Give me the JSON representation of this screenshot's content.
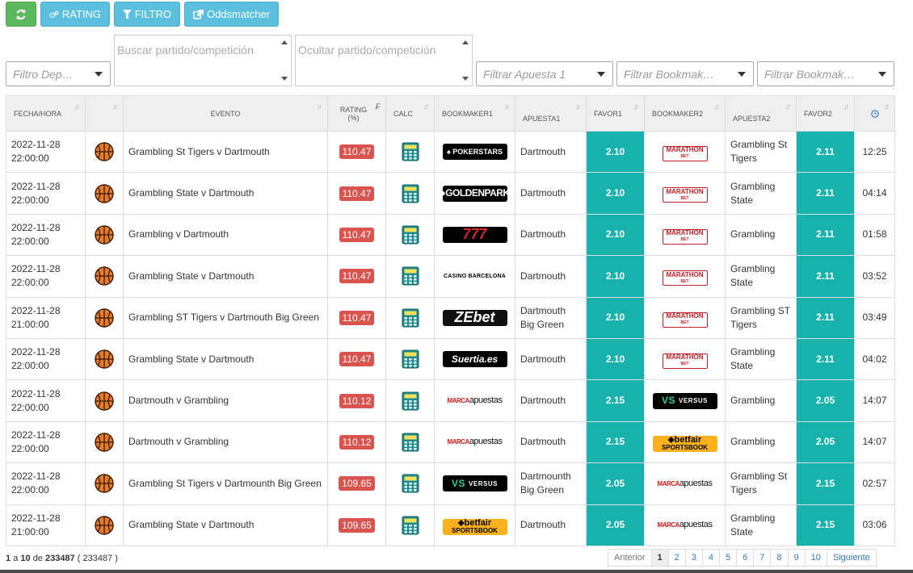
{
  "toolbar": {
    "refresh_icon": "refresh-icon",
    "rating_label": "RATING",
    "filtro_label": "FILTRO",
    "oddsmatcher_label": "Oddsmatcher"
  },
  "filters": {
    "deporte_placeholder": "Filtro Dep…",
    "buscar_placeholder": "Buscar partido/competición",
    "ocultar_placeholder": "Ocultar partido/competición",
    "apuesta1_placeholder": "Filtrar Apuesta 1",
    "bookmaker1_placeholder": "Filtrar Bookmak…",
    "bookmaker2_placeholder": "Filtrar Bookmak…"
  },
  "table": {
    "headers": {
      "fecha": "FECHA/HORA",
      "evento": "EVENTO",
      "rating": "RATING\n(%)",
      "calc": "CALC",
      "bookmaker1": "BOOKMAKER1",
      "apuesta1": "APUESTA1",
      "favor1": "FAVOR1",
      "bookmaker2": "BOOKMAKER2",
      "apuesta2": "APUESTA2",
      "favor2": "FAVOR2"
    },
    "rows": [
      {
        "date": "2022-11-28",
        "time": "22:00:00",
        "event": "Grambling St Tigers v Dartmouth",
        "rating": "110.47",
        "bookmaker1": "pokerstars",
        "apuesta1": "Dartmouth",
        "favor1": "2.10",
        "bookmaker2": "marathon",
        "apuesta2": "Grambling St Tigers",
        "favor2": "2.11",
        "age": "12:25"
      },
      {
        "date": "2022-11-28",
        "time": "22:00:00",
        "event": "Grambling State v Dartmouth",
        "rating": "110.47",
        "bookmaker1": "goldenpark",
        "apuesta1": "Dartmouth",
        "favor1": "2.10",
        "bookmaker2": "marathon",
        "apuesta2": "Grambling State",
        "favor2": "2.11",
        "age": "04:14"
      },
      {
        "date": "2022-11-28",
        "time": "22:00:00",
        "event": "Grambling v Dartmouth",
        "rating": "110.47",
        "bookmaker1": "777",
        "apuesta1": "Dartmouth",
        "favor1": "2.10",
        "bookmaker2": "marathon",
        "apuesta2": "Grambling",
        "favor2": "2.11",
        "age": "01:58"
      },
      {
        "date": "2022-11-28",
        "time": "22:00:00",
        "event": "Grambling State v Dartmouth",
        "rating": "110.47",
        "bookmaker1": "casino",
        "apuesta1": "Dartmouth",
        "favor1": "2.10",
        "bookmaker2": "marathon",
        "apuesta2": "Grambling State",
        "favor2": "2.11",
        "age": "03:52"
      },
      {
        "date": "2022-11-28",
        "time": "21:00:00",
        "event": "Grambling ST Tigers v Dartmouth Big Green",
        "rating": "110.47",
        "bookmaker1": "zebet",
        "apuesta1": "Dartmouth Big Green",
        "favor1": "2.10",
        "bookmaker2": "marathon",
        "apuesta2": "Grambling ST Tigers",
        "favor2": "2.11",
        "age": "03:49"
      },
      {
        "date": "2022-11-28",
        "time": "22:00:00",
        "event": "Grambling State v Dartmouth",
        "rating": "110.47",
        "bookmaker1": "suertia",
        "apuesta1": "Dartmouth",
        "favor1": "2.10",
        "bookmaker2": "marathon",
        "apuesta2": "Grambling State",
        "favor2": "2.11",
        "age": "04:02"
      },
      {
        "date": "2022-11-28",
        "time": "22:00:00",
        "event": "Dartmouth v Grambling",
        "rating": "110.12",
        "bookmaker1": "marca",
        "apuesta1": "Dartmouth",
        "favor1": "2.15",
        "bookmaker2": "versus",
        "apuesta2": "Grambling",
        "favor2": "2.05",
        "age": "14:07"
      },
      {
        "date": "2022-11-28",
        "time": "22:00:00",
        "event": "Dartmouth v Grambling",
        "rating": "110.12",
        "bookmaker1": "marca",
        "apuesta1": "Dartmouth",
        "favor1": "2.15",
        "bookmaker2": "betfair",
        "apuesta2": "Grambling",
        "favor2": "2.05",
        "age": "14:07"
      },
      {
        "date": "2022-11-28",
        "time": "22:00:00",
        "event": "Grambling St Tigers v Dartmounth Big Green",
        "rating": "109.65",
        "bookmaker1": "versus",
        "apuesta1": "Dartmounth Big Green",
        "favor1": "2.05",
        "bookmaker2": "marca",
        "apuesta2": "Grambling St Tigers",
        "favor2": "2.15",
        "age": "02:57"
      },
      {
        "date": "2022-11-28",
        "time": "21:00:00",
        "event": "Grambling State v Dartmouth",
        "rating": "109.65",
        "bookmaker1": "betfair",
        "apuesta1": "Dartmouth",
        "favor1": "2.05",
        "bookmaker2": "marca",
        "apuesta2": "Grambling State",
        "favor2": "2.15",
        "age": "03:06"
      }
    ]
  },
  "logos": {
    "pokerstars": "♠ POKERSTARS",
    "goldenpark": "●GOLDENPARK",
    "777": "777",
    "casino": "CASINO BARCELONA",
    "zebet": "ZEbet",
    "suertia": "Suertia.es",
    "marca_m": "MARCA",
    "marca_a": "apuestas",
    "versus_v": "VS",
    "versus_t": "VERSUS",
    "betfair_1": "⬥betfair",
    "betfair_2": "SPORTSBOOK",
    "marathon_1": "MARATHON",
    "marathon_2": "BET"
  },
  "footer": {
    "from": "1",
    "a": "a",
    "to": "10",
    "de": "de",
    "total": "233487",
    "total_paren": "( 233487 )",
    "prev": "Anterior",
    "pages": [
      "1",
      "2",
      "3",
      "4",
      "5",
      "6",
      "7",
      "8",
      "9",
      "10"
    ],
    "next": "Siguiente"
  },
  "colors": {
    "favor_bg": "#16b2ab",
    "rating_badge": "#d9534f",
    "btn_blue": "#5bc0de",
    "btn_green": "#5cb85c"
  }
}
